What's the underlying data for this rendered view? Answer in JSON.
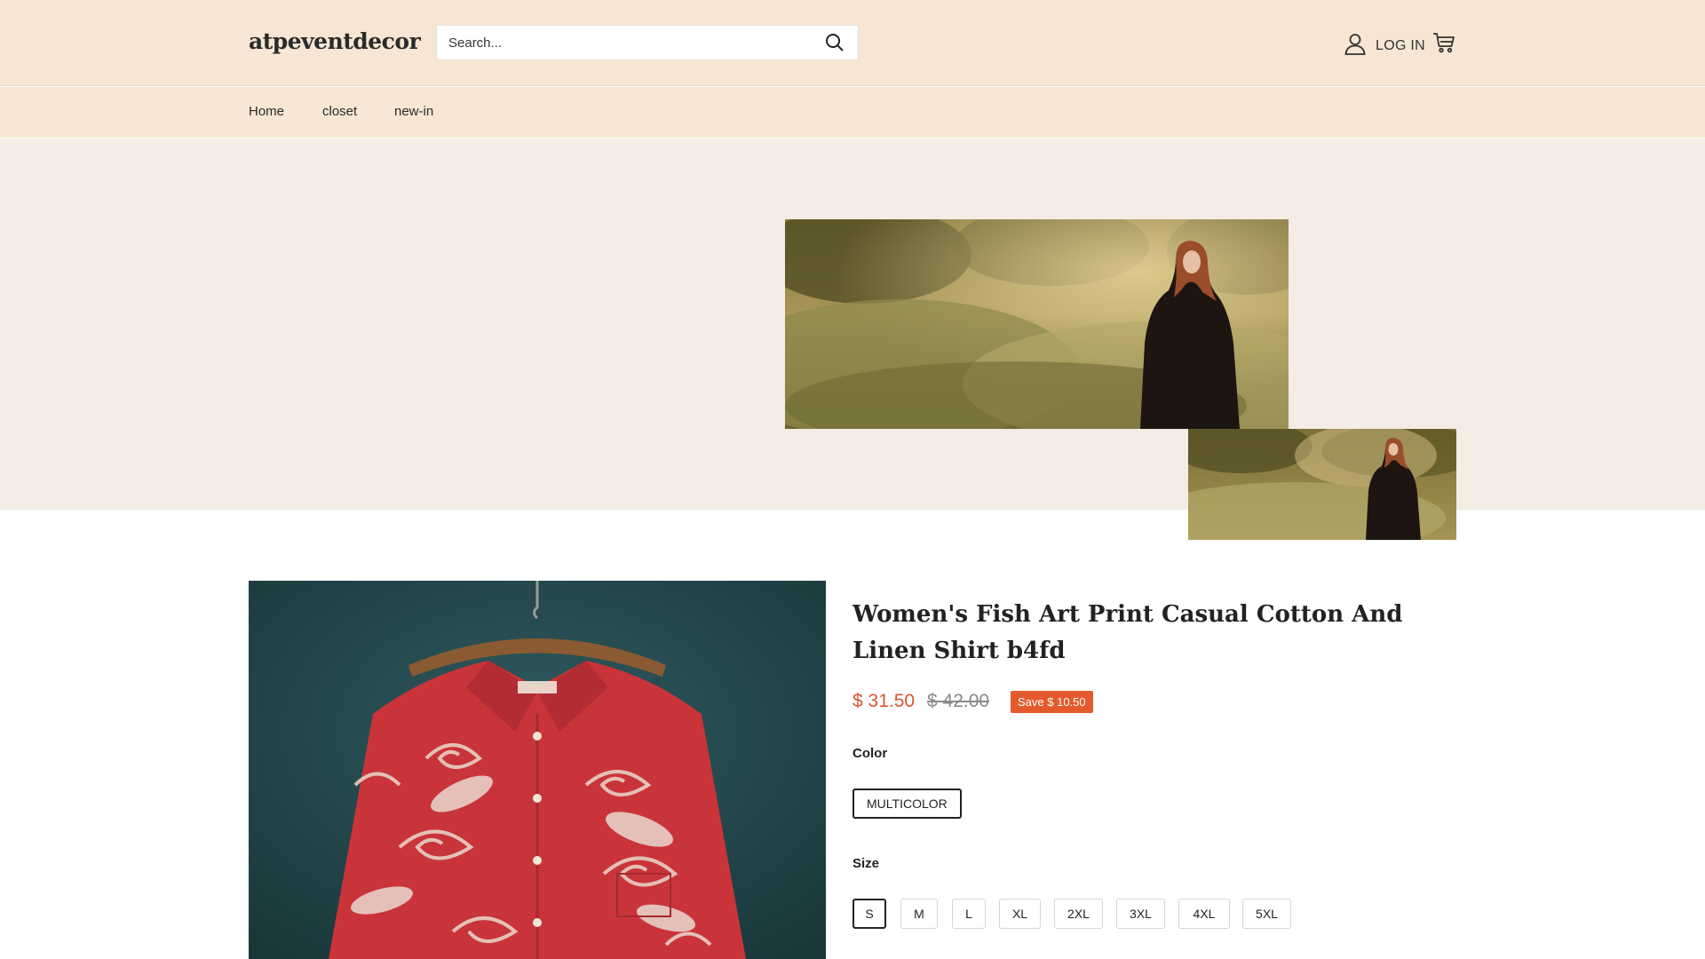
{
  "header": {
    "logo": "atpeventdecor",
    "search_placeholder": "Search...",
    "login_label": "LOG IN"
  },
  "nav": {
    "items": [
      {
        "label": "Home"
      },
      {
        "label": "closet"
      },
      {
        "label": "new-in"
      }
    ]
  },
  "product": {
    "title": "Women's Fish Art Print Casual Cotton And Linen Shirt b4fd",
    "price": "$ 31.50",
    "compare_price": "$ 42.00",
    "save_badge": "Save $ 10.50",
    "color_label": "Color",
    "color_options": [
      "MULTICOLOR"
    ],
    "selected_color": "MULTICOLOR",
    "size_label": "Size",
    "size_options": [
      "S",
      "M",
      "L",
      "XL",
      "2XL",
      "3XL",
      "4XL",
      "5XL"
    ],
    "selected_size": "S"
  },
  "colors": {
    "header_bg": "#f6e6d3",
    "banner_bg": "#f3ede6",
    "price_accent": "#d9552f",
    "badge_bg": "#e35b2c"
  },
  "icons": {
    "search": "search-icon",
    "account": "user-icon",
    "cart": "cart-icon"
  }
}
